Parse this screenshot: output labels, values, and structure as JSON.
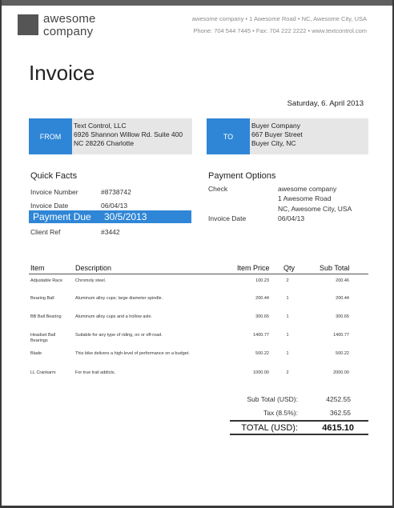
{
  "company": {
    "logo_line1": "awesome",
    "logo_line2": "company",
    "address_line": "awesome company • 1 Awesome Road • NC, Awesome City, USA",
    "contact_line": "Phone: 704 544 7445 • Fax: 704 222 2222 • www.textcontrol.com"
  },
  "title": "Invoice",
  "date": "Saturday, 6. April 2013",
  "from": {
    "tag": "FROM",
    "lines": [
      "Text Control, LLC",
      "6926 Shannon Willow Rd. Suite 400",
      "NC 28226 Charlotte"
    ]
  },
  "to": {
    "tag": "TO",
    "lines": [
      "Buyer Company",
      "667 Buyer Street",
      "Buyer City, NC"
    ]
  },
  "quick_facts": {
    "title": "Quick Facts",
    "invoice_number_label": "Invoice Number",
    "invoice_number": "#8738742",
    "invoice_date_label": "Invoice Date",
    "invoice_date": "06/04/13",
    "payment_due_label": "Payment Due",
    "payment_due": "30/5/2013",
    "client_ref_label": "Client Ref",
    "client_ref": "#3442"
  },
  "payment_options": {
    "title": "Payment Options",
    "check_label": "Check",
    "check_lines": [
      "awesome company",
      "1 Awesome Road",
      "NC, Awesome City, USA"
    ],
    "invoice_date_label": "Invoice Date",
    "invoice_date": "06/04/13"
  },
  "table": {
    "headers": {
      "item": "Item",
      "description": "Description",
      "price": "Item Price",
      "qty": "Qty",
      "subtotal": "Sub Total"
    },
    "rows": [
      {
        "item": "Adjustable Race",
        "description": "Chromoly steel.",
        "price": "100.23",
        "qty": "2",
        "subtotal": "200.46"
      },
      {
        "item": "Bearing Ball",
        "description": "Aluminum alloy cups; large diameter spindle.",
        "price": "200.44",
        "qty": "1",
        "subtotal": "200.44"
      },
      {
        "item": "BB Ball Bearing",
        "description": "Aluminum alloy cups and a hollow axle.",
        "price": "300.65",
        "qty": "1",
        "subtotal": "300.65"
      },
      {
        "item": "Headset Ball Bearings",
        "description": "Suitable for any type of riding, on or off-road.",
        "price": "1400.77",
        "qty": "1",
        "subtotal": "1400.77"
      },
      {
        "item": "Blade",
        "description": "This bike delivers a high-level of performance on a budget.",
        "price": "500.22",
        "qty": "1",
        "subtotal": "500.22"
      },
      {
        "item": "LL Crankarm",
        "description": "For true trail addicts.",
        "price": "1000.00",
        "qty": "2",
        "subtotal": "2000.00"
      }
    ]
  },
  "totals": {
    "subtotal_label": "Sub Total (USD):",
    "subtotal": "4252.55",
    "tax_label": "Tax (8.5%):",
    "tax": "362.55",
    "total_label": "TOTAL (USD):",
    "total": "4615.10"
  },
  "colors": {
    "accent": "#2f86d6",
    "panel": "#e6e6e6",
    "logo": "#555555"
  }
}
